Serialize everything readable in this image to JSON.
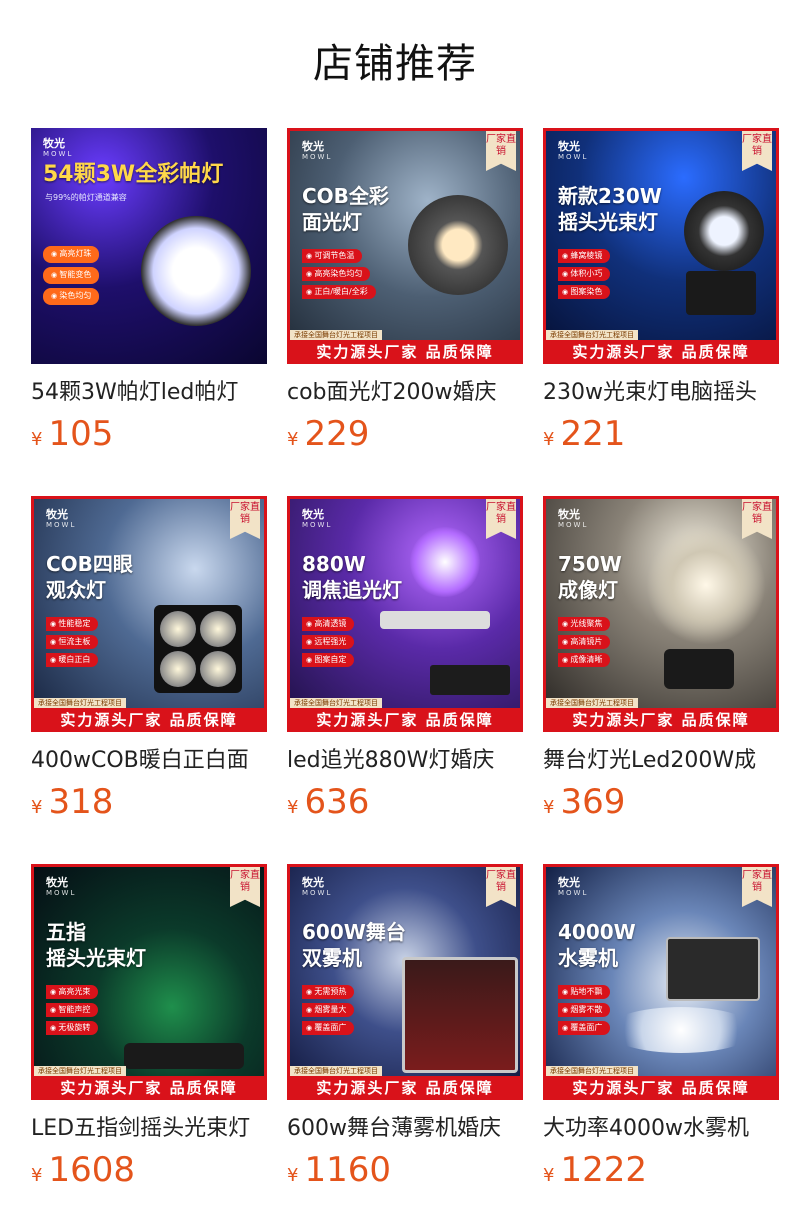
{
  "section_title": "店铺推荐",
  "badge": "厂家直销",
  "brand": {
    "cn": "牧光",
    "en": "MOWL"
  },
  "banner_top": "承接全国舞台灯光工程项目",
  "banner_main": "实力源头厂家 品质保障",
  "currency": "¥",
  "accent_color": "#e4541b",
  "frame_color": "#d9121a",
  "products": [
    {
      "name": "54颗3W帕灯led帕灯",
      "price": "105",
      "headline": "54颗3W全彩帕灯",
      "subline": "与99%的帕灯通道兼容",
      "features": [
        "高亮灯珠",
        "智能变色",
        "染色均匀"
      ],
      "image": "par-light"
    },
    {
      "name": "cob面光灯200w婚庆",
      "price": "229",
      "headline": "COB全彩\n面光灯",
      "features": [
        "可调节色温",
        "高亮染色均匀",
        "正白/暖白/全彩"
      ],
      "image": "cob-face-light"
    },
    {
      "name": "230w光束灯电脑摇头",
      "price": "221",
      "headline": "新款230W\n摇头光束灯",
      "features": [
        "蜂窝棱镜",
        "体积小巧",
        "图案染色"
      ],
      "image": "moving-head-beam"
    },
    {
      "name": "400wCOB暖白正白面",
      "price": "318",
      "headline": "COB四眼\n观众灯",
      "features": [
        "性能稳定",
        "恒流主板",
        "暖白正白"
      ],
      "image": "blinder-4-eye"
    },
    {
      "name": "led追光880W灯婚庆",
      "price": "636",
      "headline": "880W\n调焦追光灯",
      "features": [
        "高清透镜",
        "远程强光",
        "图案自定"
      ],
      "image": "follow-spot"
    },
    {
      "name": "舞台灯光Led200W成",
      "price": "369",
      "headline": "750W\n成像灯",
      "features": [
        "光线聚焦",
        "高清镜片",
        "成像清晰"
      ],
      "image": "profile-spot"
    },
    {
      "name": "LED五指剑摇头光束灯",
      "price": "1608",
      "headline": "五指\n摇头光束灯",
      "features": [
        "高亮光束",
        "智能声控",
        "无极旋转"
      ],
      "image": "five-head-beam"
    },
    {
      "name": "600w舞台薄雾机婚庆",
      "price": "1160",
      "headline": "600W舞台\n双雾机",
      "features": [
        "无需预热",
        "烟雾量大",
        "覆盖面广"
      ],
      "image": "double-fog-machine"
    },
    {
      "name": "大功率4000w水雾机",
      "price": "1222",
      "headline": "4000W\n水雾机",
      "features": [
        "贴地不飘",
        "烟雾不散",
        "覆盖面广"
      ],
      "image": "water-fog-machine"
    }
  ]
}
